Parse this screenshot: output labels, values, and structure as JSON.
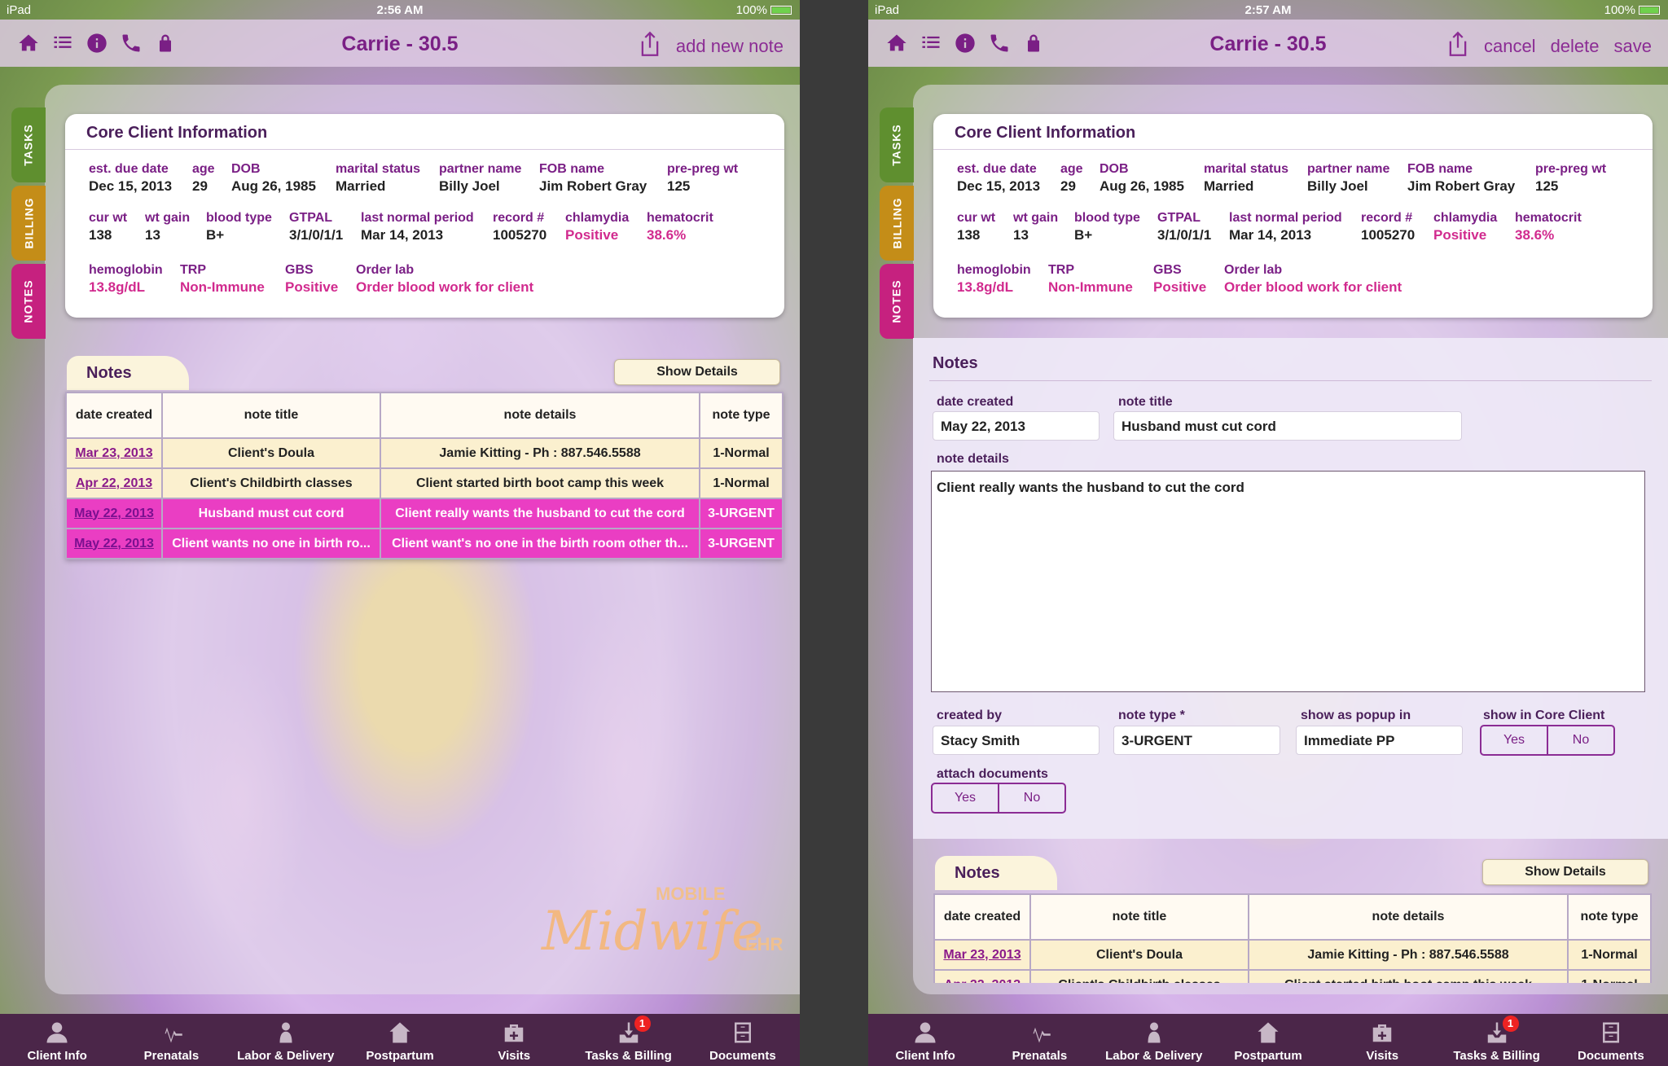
{
  "status_left": {
    "carrier": "iPad",
    "time": "2:56 AM",
    "battery": "100%"
  },
  "status_right": {
    "carrier": "iPad",
    "time": "2:57 AM",
    "battery": "100%"
  },
  "nav": {
    "title": "Carrie - 30.5",
    "left_actions": {
      "add": "add new note"
    },
    "right_actions": {
      "cancel": "cancel",
      "delete": "delete",
      "save": "save"
    },
    "icons": [
      "home-icon",
      "list-icon",
      "info-icon",
      "phone-icon",
      "lock-icon"
    ]
  },
  "side_tabs": [
    "TASKS",
    "BILLING",
    "NOTES"
  ],
  "core": {
    "title": "Core Client Information",
    "fields": {
      "due_lbl": "est. due date",
      "due_val": "Dec 15, 2013",
      "age_lbl": "age",
      "age_val": "29",
      "dob_lbl": "DOB",
      "dob_val": "Aug 26, 1985",
      "marital_lbl": "marital status",
      "marital_val": "Married",
      "partner_lbl": "partner name",
      "partner_val": "Billy Joel",
      "fob_lbl": "FOB name",
      "fob_val": "Jim Robert Gray",
      "preg_lbl": "pre-preg wt",
      "preg_val": "125",
      "curwt_lbl": "cur wt",
      "curwt_val": "138",
      "wtgain_lbl": "wt gain",
      "wtgain_val": "13",
      "blood_lbl": "blood type",
      "blood_val": "B+",
      "gtpal_lbl": "GTPAL",
      "gtpal_val": "3/1/0/1/1",
      "lnp_lbl": "last normal period",
      "lnp_val": "Mar 14, 2013",
      "record_lbl": "record #",
      "record_val": "1005270",
      "chlam_lbl": "chlamydia",
      "chlam_val": "Positive",
      "hemat_lbl": "hematocrit",
      "hemat_val": "38.6%",
      "hemo_lbl": "hemoglobin",
      "hemo_val": "13.8g/dL",
      "trp_lbl": "TRP",
      "trp_val": "Non-Immune",
      "gbs_lbl": "GBS",
      "gbs_val": "Positive",
      "lab_lbl": "Order lab",
      "lab_val": "Order blood work for client"
    }
  },
  "notes": {
    "tab_label": "Notes",
    "show_details": "Show Details",
    "columns": [
      "date created",
      "note title",
      "note details",
      "note type"
    ],
    "rows": [
      [
        "Mar 23, 2013",
        "Client's Doula",
        "Jamie Kitting - Ph : 887.546.5588",
        "1-Normal"
      ],
      [
        "Apr 22, 2013",
        "Client's Childbirth classes",
        "Client started birth boot camp this week",
        "1-Normal"
      ],
      [
        "May 22, 2013",
        "Husband must cut cord",
        "Client really wants the husband to cut the cord",
        "3-URGENT"
      ],
      [
        "May 22, 2013",
        "Client wants no one in birth ro...",
        "Client want's no one in the birth room other th...",
        "3-URGENT"
      ]
    ]
  },
  "edit": {
    "title": "Notes",
    "date_lbl": "date created",
    "date_val": "May 22, 2013",
    "title_lbl": "note title",
    "title_val": "Husband must cut cord",
    "details_lbl": "note details",
    "details_val": "Client really wants the husband to cut the cord",
    "created_lbl": "created by",
    "created_val": "Stacy Smith",
    "type_lbl": "note type *",
    "type_val": "3-URGENT",
    "popup_lbl": "show as popup in",
    "popup_val": "Immediate PP",
    "core_lbl": "show in Core Client",
    "attach_lbl": "attach documents",
    "yes": "Yes",
    "no": "No"
  },
  "logo": {
    "mobile": "MOBILE",
    "midwife": "Midwife",
    "ehr": "EHR"
  },
  "tabbar": {
    "items": [
      "Client Info",
      "Prenatals",
      "Labor & Delivery",
      "Postpartum",
      "Visits",
      "Tasks & Billing",
      "Documents"
    ],
    "badge": "1"
  },
  "colors": {
    "brand": "#7a1f85",
    "urgent": "#ea3ec3",
    "normal": "#fbf0cf"
  }
}
